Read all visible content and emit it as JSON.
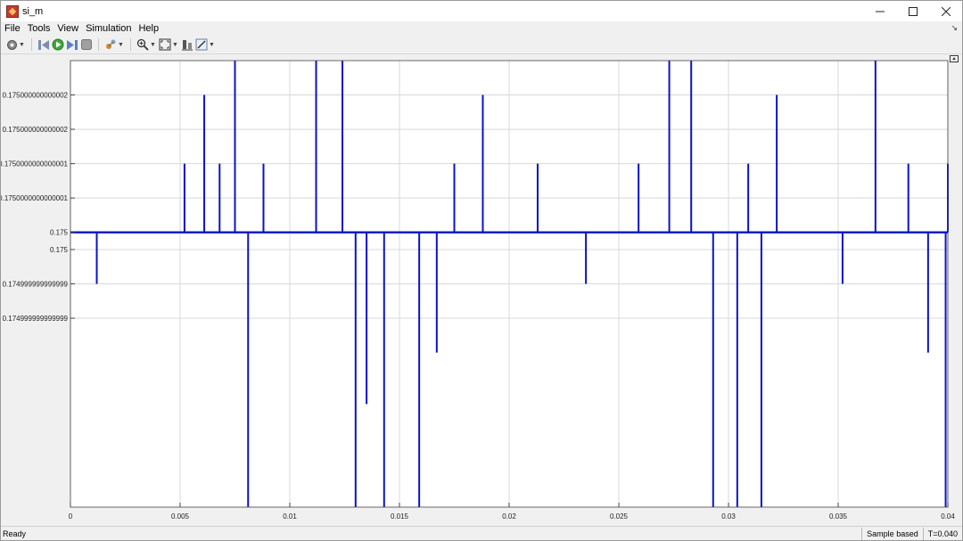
{
  "window": {
    "title": "si_m"
  },
  "menu": {
    "items": [
      "File",
      "Tools",
      "View",
      "Simulation",
      "Help"
    ]
  },
  "toolbar": {
    "icons": [
      "settings-icon",
      "step-back-icon",
      "run-icon",
      "step-forward-icon",
      "stop-icon",
      "highlight-icon",
      "zoom-icon",
      "fit-icon",
      "scale-icon",
      "style-icon"
    ]
  },
  "status": {
    "text": "Ready",
    "mode": "Sample based",
    "time": "T=0.040"
  },
  "colors": {
    "signal": "#0b13c8",
    "grid": "#d8d8d8",
    "axes_bg": "#ffffff"
  },
  "chart_data": {
    "type": "line",
    "title": "",
    "xlabel": "",
    "ylabel": "",
    "xlim": [
      0,
      0.04
    ],
    "ylim": [
      0.17499999999999954,
      0.17500000000000027
    ],
    "grid": true,
    "legend": "none",
    "x_ticks": [
      {
        "value": 0,
        "label": "0"
      },
      {
        "value": 0.005,
        "label": "0.005"
      },
      {
        "value": 0.01,
        "label": "0.01"
      },
      {
        "value": 0.015,
        "label": "0.015"
      },
      {
        "value": 0.02,
        "label": "0.02"
      },
      {
        "value": 0.025,
        "label": "0.025"
      },
      {
        "value": 0.03,
        "label": "0.03"
      },
      {
        "value": 0.035,
        "label": "0.035"
      },
      {
        "value": 0.04,
        "label": "0.04"
      }
    ],
    "y_ticks": [
      {
        "value": 0.1750000000000002,
        "label": "0.175000000000002"
      },
      {
        "value": 0.17500000000000016,
        "label": "0.175000000000002"
      },
      {
        "value": 0.1750000000000001,
        "label": "0.1750000000000001"
      },
      {
        "value": 0.17500000000000004,
        "label": "0.1750000000000001"
      },
      {
        "value": 0.175,
        "label": "0.175"
      },
      {
        "value": 0.17499999999999996,
        "label": "0.175"
      },
      {
        "value": 0.1749999999999999,
        "label": "0.174999999999999"
      },
      {
        "value": 0.17499999999999985,
        "label": "0.174999999999999"
      }
    ],
    "series": [
      {
        "baseline": 0.175,
        "x": [
          0,
          0.0012,
          0.0025,
          0.0035,
          0.005,
          0.0052,
          0.0061,
          0.0063,
          0.0068,
          0.0075,
          0.0077,
          0.0081,
          0.0088,
          0.0095,
          0.0102,
          0.0112,
          0.0117,
          0.0124,
          0.0128,
          0.013,
          0.0135,
          0.0143,
          0.0149,
          0.0159,
          0.0167,
          0.0175,
          0.0188,
          0.0197,
          0.0213,
          0.0226,
          0.0235,
          0.0248,
          0.0259,
          0.0266,
          0.0273,
          0.0283,
          0.0287,
          0.0293,
          0.0298,
          0.0304,
          0.0309,
          0.0315,
          0.0322,
          0.0335,
          0.0346,
          0.0352,
          0.0361,
          0.0367,
          0.0374,
          0.0382,
          0.0391,
          0.0399,
          0.04
        ],
        "y": [
          0.175,
          0.1749999999999999,
          0.175,
          0.175,
          0.175,
          0.1750000000000001,
          0.1750000000000002,
          0.175,
          0.1750000000000001,
          0.1750000000000007,
          0.175,
          0.1749999999999994,
          0.1750000000000001,
          0.175,
          0.175,
          0.1750000000000005,
          0.175,
          0.1750000000000061,
          0.175,
          0.1749999999999989,
          0.1749999999999997,
          0.1749999999999983,
          0.175,
          0.1749999999999995,
          0.1749999999999998,
          0.1750000000000001,
          0.1750000000000002,
          0.175,
          0.1750000000000001,
          0.175,
          0.1749999999999999,
          0.175,
          0.1750000000000001,
          0.175,
          0.1750000000000004,
          0.1750000000000005,
          0.175,
          0.1749999999999758,
          0.175,
          0.1749999999999748,
          0.1750000000000001,
          0.1749999999999991,
          0.1750000000000002,
          0.175,
          0.175,
          0.1749999999999999,
          0.175,
          0.1750000000000023,
          0.175,
          0.1750000000000001,
          0.1749999999999998,
          0.1749999999999985,
          0.1750000000000001
        ]
      }
    ]
  }
}
